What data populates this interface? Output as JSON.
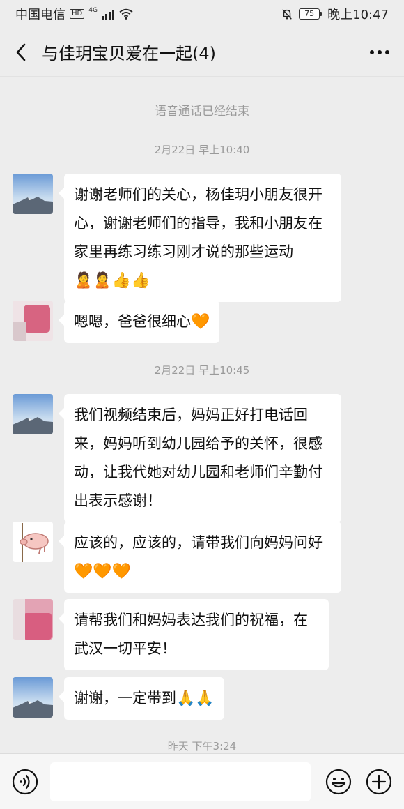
{
  "status_bar": {
    "carrier": "中国电信",
    "hd": "HD",
    "network": "4G",
    "battery": "75",
    "time": "晚上10:47"
  },
  "header": {
    "title": "与佳玥宝贝爱在一起(4)",
    "back_icon": "chevron-left-icon",
    "more_icon": "ellipsis-icon"
  },
  "chat": {
    "system_notice": "语音通话已经结束",
    "timestamps": [
      "2月22日 早上10:40",
      "2月22日 早上10:45",
      "昨天 下午3:24"
    ],
    "messages": [
      {
        "avatar": "mountain-avatar",
        "text": "谢谢老师们的关心，杨佳玥小朋友很开心，谢谢老师们的指导，我和小朋友在家里再练习练习刚才说的那些运动",
        "emojis": "🙎🙎👍👍"
      },
      {
        "avatar": "blurred-avatar",
        "text": "嗯嗯，爸爸很细心",
        "emojis": "🧡"
      },
      {
        "avatar": "mountain-avatar",
        "text": "我们视频结束后，妈妈正好打电话回来，妈妈听到幼儿园给予的关怀，很感动，让我代她对幼儿园和老师们辛勤付出表示感谢！",
        "emojis": ""
      },
      {
        "avatar": "pig-avatar",
        "text": "应该的，应该的，请带我们向妈妈问好",
        "emojis": "🧡🧡🧡"
      },
      {
        "avatar": "blurred-pink-avatar",
        "text": "请帮我们和妈妈表达我们的祝福，在武汉一切平安！",
        "emojis": ""
      },
      {
        "avatar": "mountain-avatar",
        "text": "谢谢，一定带到",
        "emojis": "🙏🙏"
      }
    ]
  },
  "input_bar": {
    "voice_icon": "voice-icon",
    "emoji_icon": "emoji-icon",
    "plus_icon": "plus-icon"
  },
  "colors": {
    "background": "#ededed",
    "bubble": "#ffffff",
    "meta_text": "#9a9a9a"
  }
}
